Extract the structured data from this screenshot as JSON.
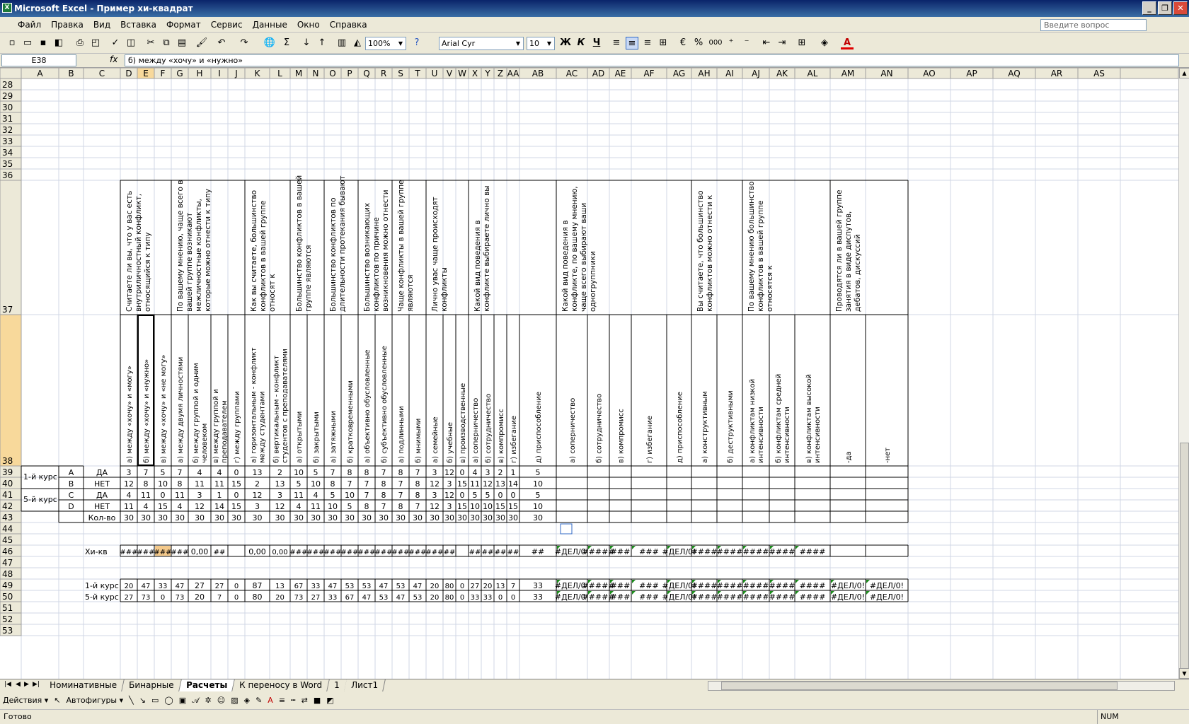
{
  "window": {
    "title": "Microsoft Excel - Пример хи-квадрат",
    "app_icon": "excel-icon",
    "controls": [
      "_",
      "❐",
      "✕"
    ]
  },
  "menu": {
    "items": [
      "Файл",
      "Правка",
      "Вид",
      "Вставка",
      "Формат",
      "Сервис",
      "Данные",
      "Окно",
      "Справка"
    ],
    "help_placeholder": "Введите вопрос"
  },
  "toolbar": {
    "zoom": "100%",
    "font": "Arial Cyr",
    "size": "10",
    "bold": "Ж",
    "italic": "К",
    "underline": "Ч",
    "percent": "%",
    "thousands": "000",
    "sum": "Σ",
    "help": "?",
    "font_color_glyph": "А"
  },
  "formula": {
    "namebox": "E38",
    "fx": "fx",
    "content": "б) между «хочу» и «нужно»"
  },
  "sheet": {
    "column_letters": [
      "A",
      "B",
      "C",
      "D",
      "E",
      "F",
      "G",
      "H",
      "I",
      "J",
      "K",
      "L",
      "M",
      "N",
      "O",
      "P",
      "Q",
      "R",
      "S",
      "T",
      "U",
      "V",
      "W",
      "X",
      "Y",
      "Z",
      "AA",
      "AB",
      "AC",
      "AD",
      "AE",
      "AF",
      "AG",
      "AH",
      "AI",
      "AJ",
      "AK",
      "AL",
      "AM",
      "AN",
      "AO",
      "AP",
      "AQ",
      "AR",
      "AS"
    ],
    "selected_cell": "E38",
    "rows": {
      "28": [],
      "29": [],
      "30": [],
      "31": [],
      "32": [],
      "33": [],
      "34": [],
      "35": [],
      "36": [],
      "44": [],
      "45": [],
      "47": [],
      "48": [],
      "51": [],
      "52": [],
      "53": []
    },
    "question_headers": [
      {
        "start": "D",
        "end": "F",
        "text": "Считаете ли вы, что у вас есть внутриличностный конфликт, относящийся к типу"
      },
      {
        "start": "G",
        "end": "J",
        "text": "По вашему мнению, чаще всего в вашей группе возникают межличностные конфликты, которые можно отнести к типу"
      },
      {
        "start": "K",
        "end": "L",
        "text": "Как вы считаете, большинство конфликтов в вашей группе относят к"
      },
      {
        "start": "M",
        "end": "N",
        "text": "Большинство конфликтов в вашей группе являются"
      },
      {
        "start": "O",
        "end": "P",
        "text": "Большинство конфликтов по длительности протекания бывают"
      },
      {
        "start": "Q",
        "end": "R",
        "text": "Большинство возникающих конфликтов по причине возникновения можно отнести"
      },
      {
        "start": "S",
        "end": "T",
        "text": "Чаще конфликты в вашей группе являются"
      },
      {
        "start": "U",
        "end": "W",
        "text": "Лично увас чаще происходят конфликты"
      },
      {
        "start": "X",
        "end": "AB",
        "text": "Какой вид поведения в конфликте выбираете лично вы"
      },
      {
        "start": "AC",
        "end": "AG",
        "text": "Какой вид поведения в конфликте, по вашему мнению, чаще всего выбирают ваши одногруппники"
      },
      {
        "start": "AH",
        "end": "AI",
        "text": "Вы считаете, что большинство конфликтов можно отнести к"
      },
      {
        "start": "AJ",
        "end": "AL",
        "text": "По вашему мнению большинство конфликтов в вашей группе относятся к"
      },
      {
        "start": "AM",
        "end": "AN",
        "text": "Проводятся ли в вашей группе занятия в виде диспутов, дебатов, дискуссий"
      }
    ],
    "option_headers": {
      "D": "а) между «хочу» и «могу»",
      "E": "б) между «хочу» и «нужно»",
      "F": "в) между «хочу» и «не могу»",
      "G": "а) между двумя личностями",
      "H": "б) между группой и одним человеком",
      "I": "в) между группой и преподавателем",
      "J": "г) между группами",
      "K": "а) горизонтальным - конфликт между студентами",
      "L": "б) вертикальным - конфликт студентов с преподавателями",
      "M": "а) открытыми",
      "N": "б) закрытыми",
      "O": "а) затяжными",
      "P": "б) кратковременными",
      "Q": "а) объективно обусловленные",
      "R": "б) субъективно обусловленные",
      "S": "а) подлинными",
      "T": "б) мнимыми",
      "U": "а) семейные",
      "V": "б) учебные",
      "W": "в) производственные",
      "X": "а) соперничество",
      "Y": "б) сотрудничество",
      "Z": "в) компромисс",
      "AA": "г) избегание",
      "AB": "д) приспособление",
      "AC": "а) соперничество",
      "AD": "б) сотрудничество",
      "AE": "в) компромисс",
      "AF": "г) избегание",
      "AG": "д) приспособление",
      "AH": "а) конструктивным",
      "AI": "б) деструктивными",
      "AJ": "а) конфликтам низкой интенсивности",
      "AK": "б) конфликтам средней интенсивности",
      "AL": "в) конфликтам высокой интенсивности",
      "AM": "-да",
      "AN": "-нет"
    },
    "groups": {
      "g1": "1-й курс",
      "g5": "5-й курс"
    },
    "table_rows": [
      {
        "row": "39",
        "b": "A",
        "c": "ДА",
        "vals": [
          "3",
          "7",
          "5",
          "7",
          "4",
          "4",
          "0",
          "13",
          "2",
          "10",
          "5",
          "7",
          "8",
          "8",
          "7",
          "8",
          "7",
          "3",
          "12",
          "0",
          "4",
          "3",
          "2",
          "1",
          "5"
        ]
      },
      {
        "row": "40",
        "b": "B",
        "c": "НЕТ",
        "vals": [
          "12",
          "8",
          "10",
          "8",
          "11",
          "11",
          "15",
          "2",
          "13",
          "5",
          "10",
          "8",
          "7",
          "7",
          "8",
          "7",
          "8",
          "12",
          "3",
          "15",
          "11",
          "12",
          "13",
          "14",
          "10"
        ]
      },
      {
        "row": "41",
        "b": "C",
        "c": "ДА",
        "vals": [
          "4",
          "11",
          "0",
          "11",
          "3",
          "1",
          "0",
          "12",
          "3",
          "11",
          "4",
          "5",
          "10",
          "7",
          "8",
          "7",
          "8",
          "3",
          "12",
          "0",
          "5",
          "5",
          "0",
          "0",
          "5"
        ]
      },
      {
        "row": "42",
        "b": "D",
        "c": "НЕТ",
        "vals": [
          "11",
          "4",
          "15",
          "4",
          "12",
          "14",
          "15",
          "3",
          "12",
          "4",
          "11",
          "10",
          "5",
          "8",
          "7",
          "8",
          "7",
          "12",
          "3",
          "15",
          "10",
          "10",
          "15",
          "15",
          "10"
        ]
      },
      {
        "row": "43",
        "b": "",
        "c": "Кол-во",
        "vals": [
          "30",
          "30",
          "30",
          "30",
          "30",
          "30",
          "30",
          "30",
          "30",
          "30",
          "30",
          "30",
          "30",
          "30",
          "30",
          "30",
          "30",
          "30",
          "30",
          "30",
          "30",
          "30",
          "30",
          "30",
          "30"
        ]
      }
    ],
    "row46": {
      "label": "Хи-кв",
      "vals": [
        "###",
        "###",
        "###",
        "###",
        "0,00",
        "##",
        "",
        "0,00",
        "0,00",
        "###",
        "###",
        "###",
        "###",
        "###",
        "###",
        "###",
        "###",
        "###",
        "##",
        "",
        "##",
        "##",
        "##",
        "##",
        "##",
        "#ДЕЛ/0!",
        "#####",
        "###",
        "###",
        "#ДЕЛ/0!",
        "####",
        "####",
        "####",
        "####",
        "####"
      ]
    },
    "row49": {
      "label": "1-й курс",
      "vals": [
        "20",
        "47",
        "33",
        "47",
        "27",
        "27",
        "0",
        "87",
        "13",
        "67",
        "33",
        "47",
        "53",
        "53",
        "47",
        "53",
        "47",
        "20",
        "80",
        "0",
        "27",
        "20",
        "13",
        "7",
        "33",
        "#ДЕЛ/0!",
        "#####",
        "###",
        "###",
        "#ДЕЛ/0!",
        "####",
        "####",
        "####",
        "####",
        "####",
        "#ДЕЛ/0!",
        "#ДЕЛ/0!"
      ]
    },
    "row50": {
      "label": "5-й курс",
      "vals": [
        "27",
        "73",
        "0",
        "73",
        "20",
        "7",
        "0",
        "80",
        "20",
        "73",
        "27",
        "33",
        "67",
        "47",
        "53",
        "47",
        "53",
        "20",
        "80",
        "0",
        "33",
        "33",
        "0",
        "0",
        "33",
        "#ДЕЛ/0!",
        "#####",
        "###",
        "###",
        "#ДЕЛ/0!",
        "####",
        "####",
        "####",
        "####",
        "####",
        "#ДЕЛ/0!",
        "#ДЕЛ/0!"
      ]
    },
    "paste_options_icon": "paste-options-icon"
  },
  "sheet_tabs": [
    "Номинативные",
    "Бинарные",
    "Расчеты",
    "К переносу в Word",
    "1",
    "Лист1"
  ],
  "active_tab": "Расчеты",
  "drawbar": {
    "actions": "Действия ▾",
    "autoshapes": "Автофигуры ▾"
  },
  "status": {
    "ready": "Готово",
    "num": "NUM"
  },
  "colors": {
    "title_bar": "#0a246a",
    "chrome": "#ece9d8",
    "grid_line": "#d0d7e5",
    "header_bg": "#ece9d8",
    "selected_fill": "#f4c98a",
    "error_marker": "#1a8a1a"
  }
}
